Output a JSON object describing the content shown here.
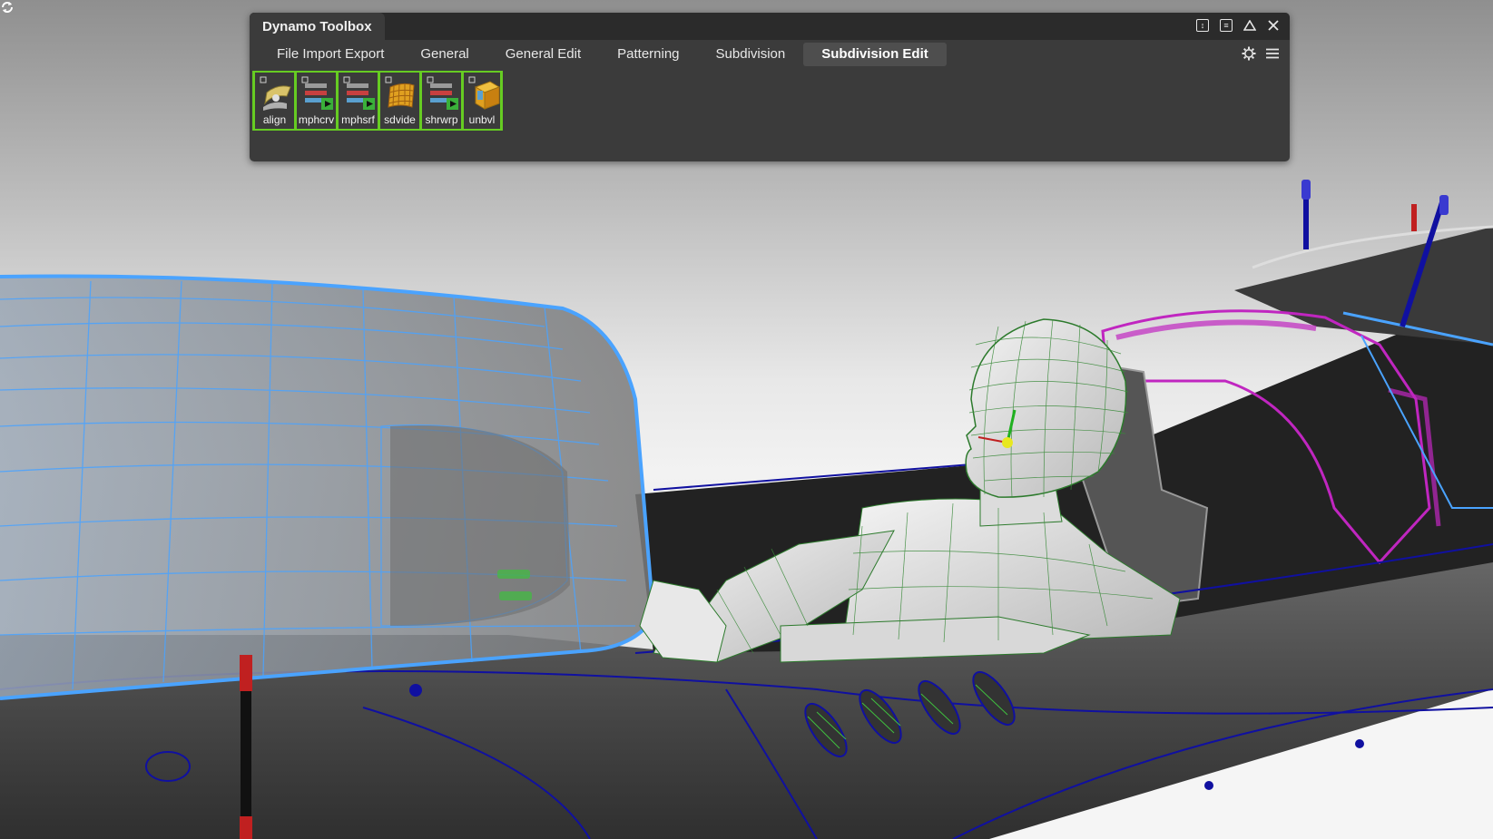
{
  "window": {
    "title": "Dynamo Toolbox",
    "controls": [
      {
        "name": "dock-toggle-button",
        "icon": "dock-icon"
      },
      {
        "name": "panel-menu-button",
        "icon": "list-icon"
      },
      {
        "name": "collapse-button",
        "icon": "triangle-up-icon"
      },
      {
        "name": "close-button",
        "icon": "close-icon"
      }
    ]
  },
  "tabs": [
    {
      "label": "File Import Export",
      "active": false
    },
    {
      "label": "General",
      "active": false
    },
    {
      "label": "General Edit",
      "active": false
    },
    {
      "label": "Patterning",
      "active": false
    },
    {
      "label": "Subdivision",
      "active": false
    },
    {
      "label": "Subdivision Edit",
      "active": true
    }
  ],
  "tab_tools": [
    {
      "name": "settings-button",
      "icon": "gear-icon"
    },
    {
      "name": "tabs-menu-button",
      "icon": "hamburger-icon"
    }
  ],
  "shelf": [
    {
      "label": "align",
      "icon": "align-icon"
    },
    {
      "label": "mphcrv",
      "icon": "mphcrv-icon"
    },
    {
      "label": "mphsrf",
      "icon": "mphsrf-icon"
    },
    {
      "label": "sdvide",
      "icon": "sdvide-icon"
    },
    {
      "label": "shrwrp",
      "icon": "shrwrp-icon"
    },
    {
      "label": "unbvl",
      "icon": "unbvl-icon"
    }
  ],
  "viewport": {
    "scene": "car-cockpit-wireframe",
    "accent_colors": {
      "selection_blue": "#4aa3ff",
      "wire_green": "#3fbf3f",
      "magenta": "#c026c0",
      "navy_lines": "#1010a0",
      "shelf_border": "#66cc22"
    }
  }
}
